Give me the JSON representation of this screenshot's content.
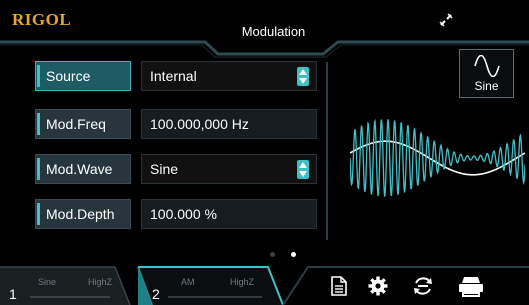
{
  "header": {
    "logo": "RIGOL",
    "title": "Modulation",
    "link_icon": "link-icon"
  },
  "params": [
    {
      "label": "Source",
      "value": "Internal",
      "active": true,
      "selectable": true
    },
    {
      "label": "Mod.Freq",
      "value": "100.000,000 Hz",
      "active": false,
      "selectable": false
    },
    {
      "label": "Mod.Wave",
      "value": "Sine",
      "active": false,
      "selectable": true
    },
    {
      "label": "Mod.Depth",
      "value": "100.000 %",
      "active": false,
      "selectable": false
    }
  ],
  "preview": {
    "shape_button_label": "Sine"
  },
  "pages": {
    "total": 2,
    "current": 2
  },
  "channels": [
    {
      "number": "1",
      "wave": "Sine",
      "load": "HighZ"
    },
    {
      "number": "2",
      "wave": "AM",
      "load": "HighZ"
    }
  ],
  "toolbar_icons": [
    "file-icon",
    "settings-gear-icon",
    "sync-icon",
    "print-icon"
  ],
  "colors": {
    "accent": "#3fc1c9",
    "logo": "#e7a62a",
    "panel": "#27353d",
    "background": "#000000"
  }
}
